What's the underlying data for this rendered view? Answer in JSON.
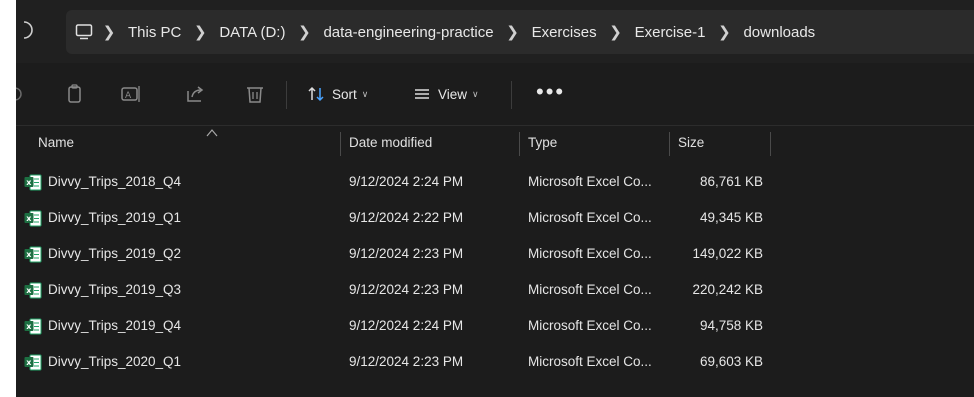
{
  "address_bar": {
    "location_icon": "computer-monitor-icon",
    "breadcrumbs": [
      "This PC",
      "DATA (D:)",
      "data-engineering-practice",
      "Exercises",
      "Exercise-1",
      "downloads"
    ]
  },
  "toolbar": {
    "sort_label": "Sort",
    "view_label": "View",
    "more_label": "•••"
  },
  "columns": {
    "name": "Name",
    "date_modified": "Date modified",
    "type": "Type",
    "size": "Size"
  },
  "files": [
    {
      "name": "Divvy_Trips_2018_Q4",
      "date": "9/12/2024 2:24 PM",
      "type": "Microsoft Excel Co...",
      "size": "86,761 KB"
    },
    {
      "name": "Divvy_Trips_2019_Q1",
      "date": "9/12/2024 2:22 PM",
      "type": "Microsoft Excel Co...",
      "size": "49,345 KB"
    },
    {
      "name": "Divvy_Trips_2019_Q2",
      "date": "9/12/2024 2:23 PM",
      "type": "Microsoft Excel Co...",
      "size": "149,022 KB"
    },
    {
      "name": "Divvy_Trips_2019_Q3",
      "date": "9/12/2024 2:23 PM",
      "type": "Microsoft Excel Co...",
      "size": "220,242 KB"
    },
    {
      "name": "Divvy_Trips_2019_Q4",
      "date": "9/12/2024 2:24 PM",
      "type": "Microsoft Excel Co...",
      "size": "94,758 KB"
    },
    {
      "name": "Divvy_Trips_2020_Q1",
      "date": "9/12/2024 2:23 PM",
      "type": "Microsoft Excel Co...",
      "size": "69,603 KB"
    }
  ],
  "colors": {
    "background": "#1c1c1c",
    "address_bar": "#2b2b2b",
    "text": "#e6e6e6",
    "excel_green": "#1d6f42"
  }
}
